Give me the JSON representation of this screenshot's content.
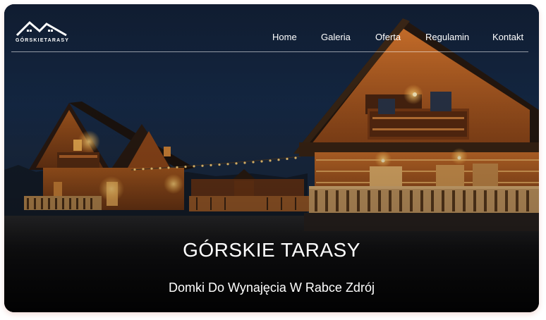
{
  "logo": {
    "text": "GÓRSKIETARASY",
    "icon": "mountain-roof-logo-icon"
  },
  "nav": {
    "items": [
      "Home",
      "Galeria",
      "Oferta",
      "Regulamin",
      "Kontakt"
    ]
  },
  "hero": {
    "title": "GÓRSKIE TARASY",
    "subtitle": "Domki Do Wynajęcia W Rabce Zdrój",
    "image": "night-photo-of-two-wooden-log-cabins"
  },
  "colors": {
    "sky": "#13233d",
    "wood_glow": "#d9842f",
    "ground": "#0b0b0d",
    "text": "#ffffff",
    "shadow_tint": "#e0a296"
  }
}
